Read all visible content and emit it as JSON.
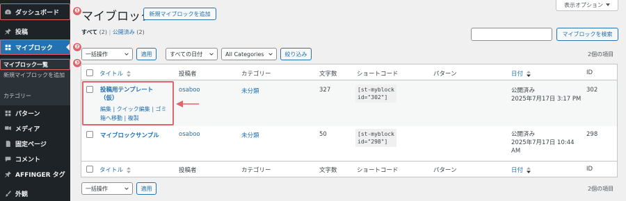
{
  "sidebar": {
    "items": [
      {
        "label": "ダッシュボード",
        "icon": "dashboard-icon"
      },
      {
        "label": "投稿",
        "icon": "pin-icon"
      },
      {
        "label": "マイブロック",
        "icon": "blocks-icon"
      },
      {
        "label": "パターン",
        "icon": "pattern-icon"
      },
      {
        "label": "メディア",
        "icon": "media-icon"
      },
      {
        "label": "固定ページ",
        "icon": "pages-icon"
      },
      {
        "label": "コメント",
        "icon": "comments-icon"
      },
      {
        "label": "AFFINGER タグ",
        "icon": "pin-icon"
      },
      {
        "label": "外観",
        "icon": "brush-icon"
      }
    ],
    "submenu": [
      "マイブロック一覧",
      "新規マイブロックを追加",
      "カテゴリー"
    ]
  },
  "annotations": {
    "badge1": "❶",
    "badge2": "❷",
    "badge3": "❸",
    "color": "#e0646a"
  },
  "header": {
    "title": "マイブロック",
    "add_new": "新規マイブロックを追加",
    "screen_options": "表示オプション"
  },
  "views": {
    "all": "すべて",
    "all_count": "(2)",
    "published": "公開済み",
    "published_count": "(2)"
  },
  "search": {
    "button": "マイブロックを検索",
    "placeholder": ""
  },
  "filters": {
    "bulk": "一括操作",
    "apply": "適用",
    "dates": "すべての日付",
    "categories": "All Categories",
    "filter": "絞り込み",
    "items_count": "2個の項目"
  },
  "table": {
    "columns": {
      "title": "タイトル",
      "author": "投稿者",
      "category": "カテゴリー",
      "chars": "文字数",
      "shortcode": "ショートコード",
      "pattern": "パターン",
      "date": "日付",
      "id": "ID"
    },
    "rows": [
      {
        "title_line1": "投稿用テンプレート",
        "title_line2": "（仮）",
        "actions_line1": "編集 | クイック編集 | ゴミ",
        "actions_line2": "箱へ移動 | 複製",
        "author": "osaboo",
        "category": "未分類",
        "chars": "327",
        "code_line1": "[st-myblock",
        "code_line2": "id=\"302\"]",
        "status": "公開済み",
        "date": "2025年7月17日 3:17 PM",
        "id": "302"
      },
      {
        "title_line1": "マイブロックサンプル",
        "author": "osaboo",
        "category": "未分類",
        "chars": "50",
        "code_line1": "[st-myblock",
        "code_line2": "id=\"298\"]",
        "status": "公開済み",
        "date_line1": "2025年7月17日 10:44",
        "date_line2": "AM",
        "id": "298"
      }
    ]
  },
  "footer": {
    "bulk": "一括操作",
    "apply": "適用",
    "items_count": "2個の項目"
  }
}
